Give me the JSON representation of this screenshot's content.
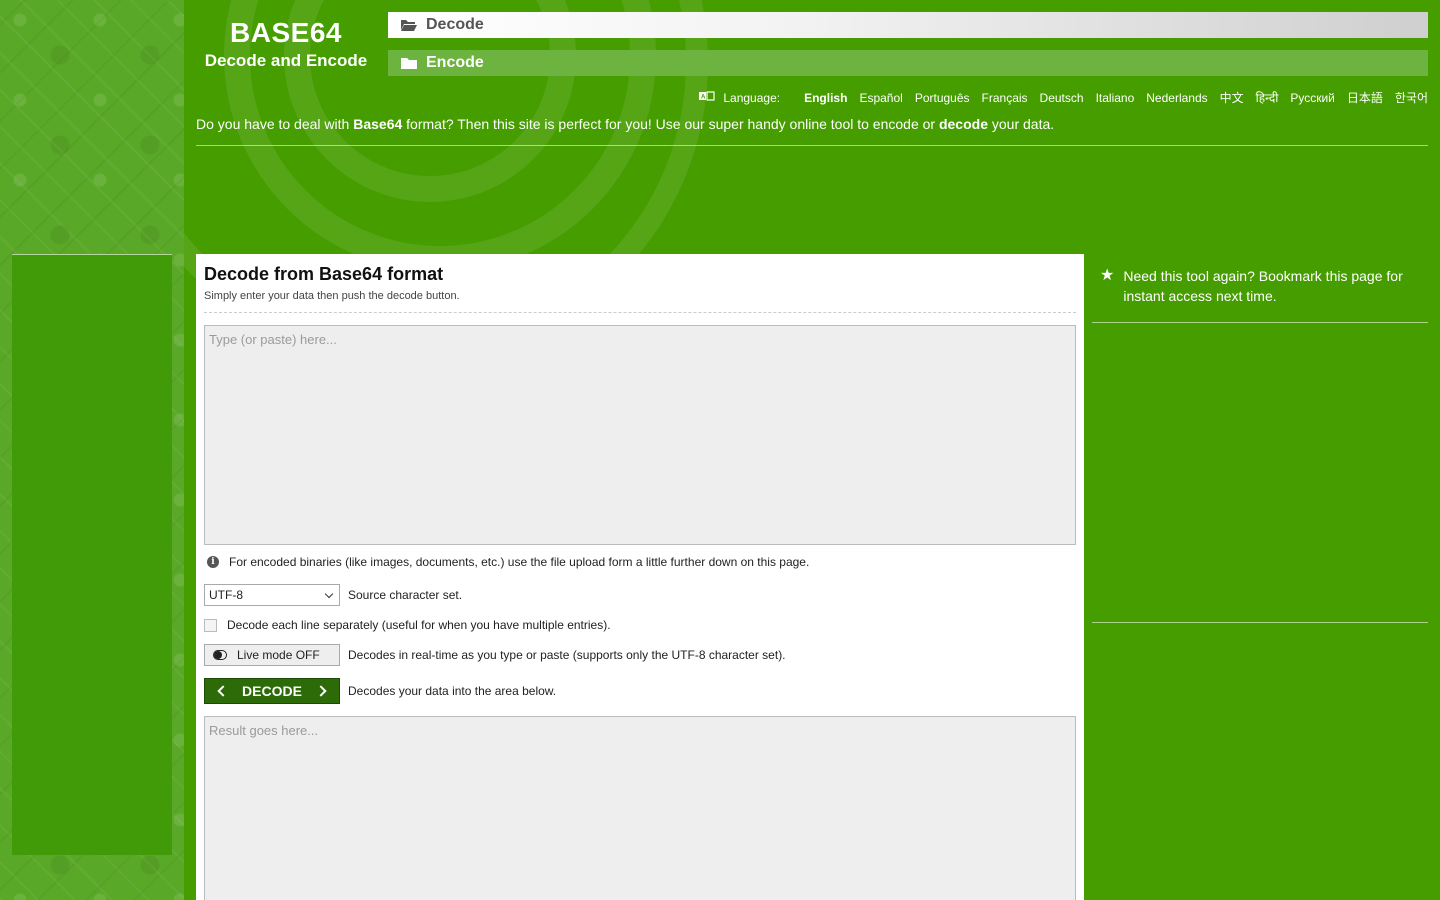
{
  "logo": {
    "title": "BASE64",
    "subtitle": "Decode and Encode"
  },
  "nav": {
    "decode_label": "Decode",
    "encode_label": "Encode",
    "decode_icon": "folder-open-icon",
    "encode_icon": "folder-icon"
  },
  "language": {
    "label": "Language:",
    "icon": "language-icon",
    "items": [
      "English",
      "Español",
      "Português",
      "Français",
      "Deutsch",
      "Italiano",
      "Nederlands",
      "中文",
      "हिन्दी",
      "Русский",
      "日本語",
      "한국어"
    ],
    "active": "English"
  },
  "intro": {
    "part1": "Do you have to deal with ",
    "bold1": "Base64",
    "part2": " format? Then this site is perfect for you! Use our super handy online tool to encode or ",
    "bold2": "decode",
    "part3": " your data."
  },
  "panel": {
    "title": "Decode from Base64 format",
    "subtitle": "Simply enter your data then push the decode button.",
    "input_placeholder": "Type (or paste) here...",
    "info_text": "For encoded binaries (like images, documents, etc.) use the file upload form a little further down on this page.",
    "charset_value": "UTF-8",
    "charset_desc": "Source character set.",
    "checkbox_label": "Decode each line separately (useful for when you have multiple entries).",
    "live_mode_label": "Live mode OFF",
    "live_mode_desc": "Decodes in real-time as you type or paste (supports only the UTF-8 character set).",
    "decode_button_label": "DECODE",
    "decode_desc": "Decodes your data into the area below.",
    "result_placeholder": "Result goes here..."
  },
  "sidebar": {
    "bookmark_text": "Need this tool again? Bookmark this page for instant access next time."
  },
  "colors": {
    "background_green": "#459d00",
    "nav_encode_green": "#6db33f",
    "button_green": "#2d6a08"
  }
}
